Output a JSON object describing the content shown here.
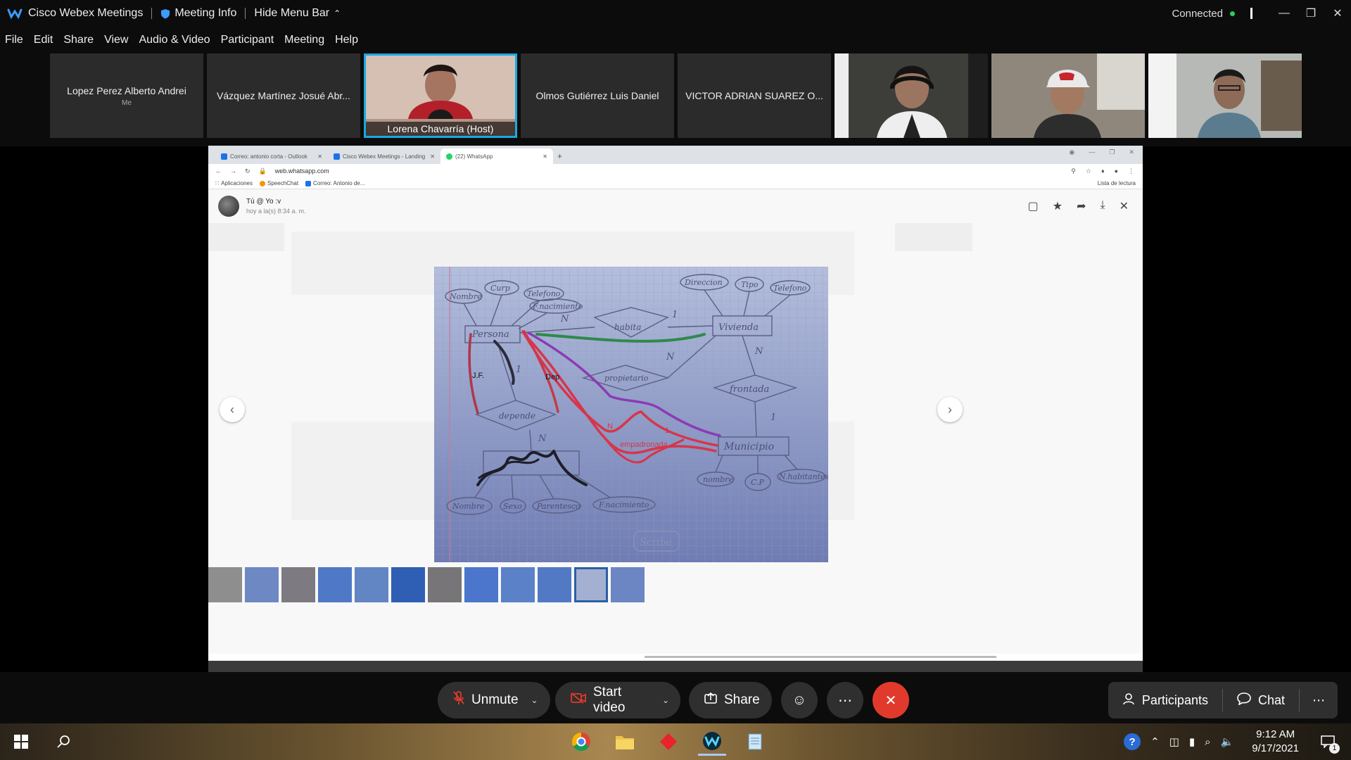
{
  "titlebar": {
    "app_name": "Cisco Webex Meetings",
    "meeting_info": "Meeting Info",
    "hide_menu": "Hide Menu Bar",
    "status": "Connected"
  },
  "menu": [
    "File",
    "Edit",
    "Share",
    "View",
    "Audio & Video",
    "Participant",
    "Meeting",
    "Help"
  ],
  "participants": [
    {
      "name": "Lopez Perez Alberto Andrei",
      "sub": "Me"
    },
    {
      "name": "Vázquez Martínez Josué Abr..."
    },
    {
      "name": "Lorena Chavarría  (Host)"
    },
    {
      "name": "Olmos Gutiérrez Luis Daniel"
    },
    {
      "name": "VICTOR ADRIAN SUAREZ O..."
    }
  ],
  "browser": {
    "tabs": [
      "Correo: antonio corta - Outlook",
      "Cisco Webex Meetings - Landing",
      "(22) WhatsApp"
    ],
    "url": "web.whatsapp.com",
    "bookmarks": [
      "Aplicaciones",
      "SpeechChat",
      "Correo: Antonio de..."
    ],
    "reading_list": "Lista de lectura"
  },
  "viewer": {
    "sender": "Tú @ Yo :v",
    "timestamp": "hoy a la(s) 8:34 a. m."
  },
  "diagram": {
    "entities": [
      "Persona",
      "Vivienda",
      "Municipio"
    ],
    "relations": [
      "habita",
      "depende",
      "propietario",
      "frontada"
    ],
    "attributes": [
      "Nombre",
      "Curp",
      "Telefono",
      "F.nacimiento",
      "Direccion",
      "Tipo",
      "Telefono",
      "nombre",
      "C.P",
      "N.habitantes",
      "Nombre",
      "Sexo",
      "Parentesco",
      "F.nacimiento"
    ],
    "cardinalities": [
      "N",
      "1",
      "N",
      "N",
      "1",
      "N",
      "1"
    ],
    "annotations": [
      "J.F.",
      "Dep",
      "N",
      "1",
      "empadronada"
    ],
    "watermark": "Scribe"
  },
  "controls": {
    "unmute": "Unmute",
    "start_video": "Start video",
    "share": "Share",
    "participants": "Participants",
    "chat": "Chat"
  },
  "taskbar": {
    "time": "9:12 AM",
    "date": "9/17/2021",
    "notifications": "1"
  },
  "colors": {
    "host_border": "#17a9e4",
    "end_button": "#e13a2c",
    "connected": "#2fcb5a"
  }
}
